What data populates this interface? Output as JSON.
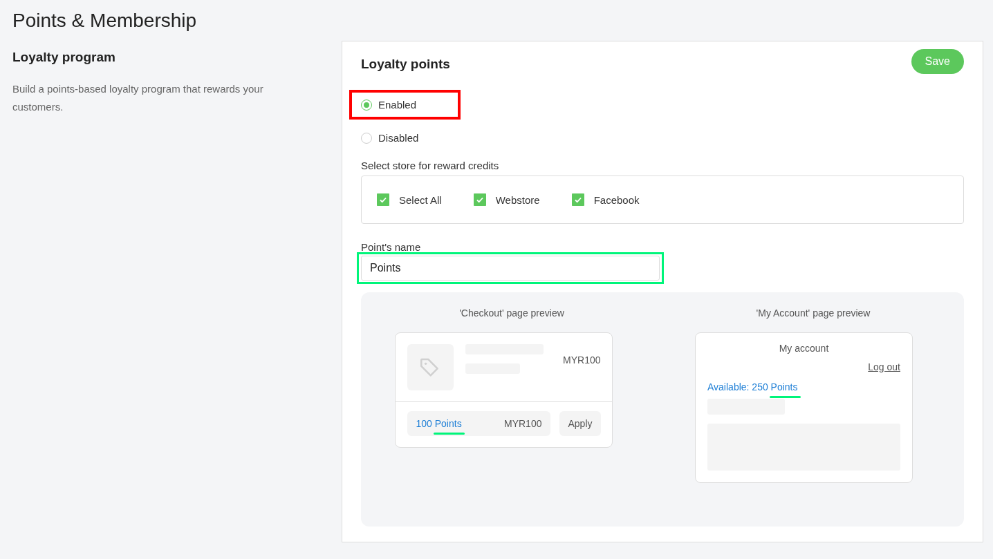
{
  "page_title": "Points & Membership",
  "section": {
    "title": "Loyalty program",
    "description": "Build a points-based loyalty program that rewards your customers."
  },
  "card": {
    "title": "Loyalty points",
    "save_button": "Save",
    "status_options": [
      {
        "label": "Enabled",
        "selected": true,
        "highlighted": true
      },
      {
        "label": "Disabled",
        "selected": false,
        "highlighted": false
      }
    ],
    "stores_label": "Select store for reward credits",
    "stores": [
      {
        "label": "Select All",
        "checked": true
      },
      {
        "label": "Webstore",
        "checked": true
      },
      {
        "label": "Facebook",
        "checked": true
      }
    ],
    "points_name": {
      "label": "Point's name",
      "value": "Points",
      "highlighted": true
    },
    "checkout_preview": {
      "title": "'Checkout' page preview",
      "price": "MYR100",
      "points_amount": "100",
      "points_unit": "Points",
      "unit_highlighted": true,
      "points_value": "MYR100",
      "apply_button": "Apply"
    },
    "account_preview": {
      "title": "'My Account' page preview",
      "heading": "My account",
      "logout_link": "Log out",
      "available": "Available: 250",
      "points_unit": "Points",
      "unit_highlighted": true
    }
  }
}
